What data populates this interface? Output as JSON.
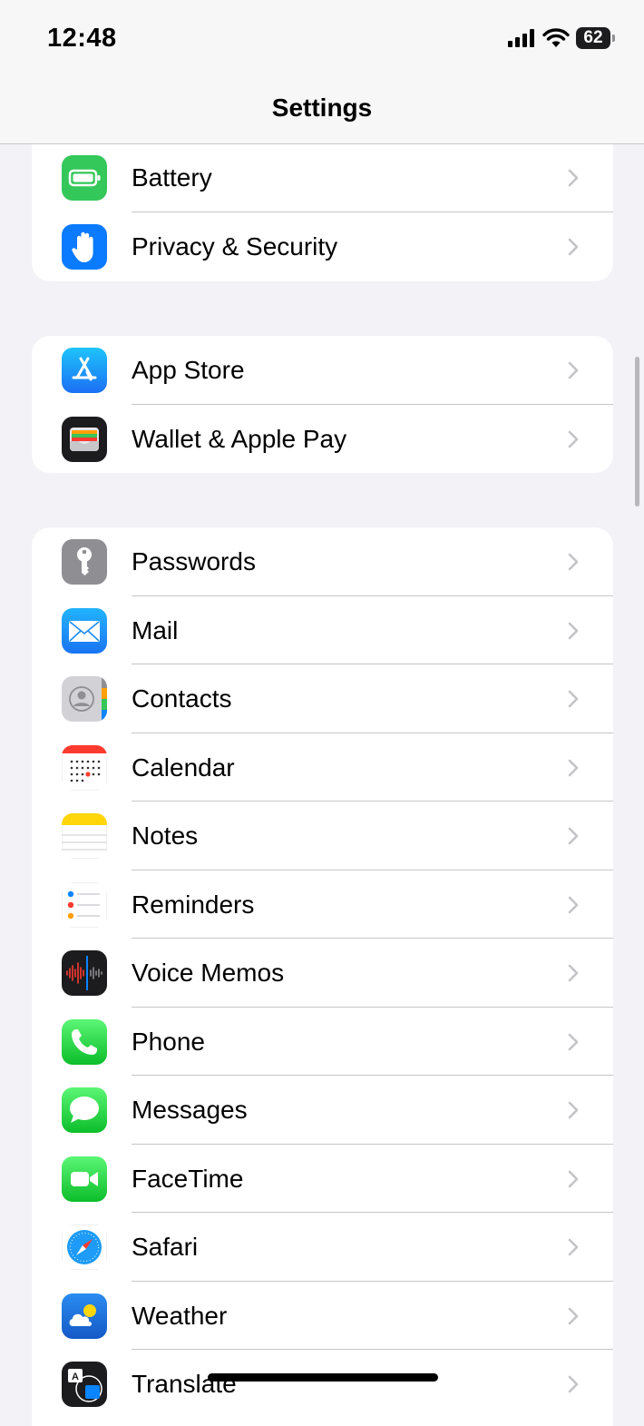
{
  "status_bar": {
    "time": "12:48",
    "battery_level": "62"
  },
  "nav": {
    "title": "Settings"
  },
  "groups": [
    {
      "items": [
        {
          "label": "Battery",
          "icon": "battery-icon"
        },
        {
          "label": "Privacy & Security",
          "icon": "hand-icon"
        }
      ]
    },
    {
      "items": [
        {
          "label": "App Store",
          "icon": "app-store-icon"
        },
        {
          "label": "Wallet & Apple Pay",
          "icon": "wallet-icon"
        }
      ]
    },
    {
      "items": [
        {
          "label": "Passwords",
          "icon": "key-icon"
        },
        {
          "label": "Mail",
          "icon": "mail-icon"
        },
        {
          "label": "Contacts",
          "icon": "contacts-icon"
        },
        {
          "label": "Calendar",
          "icon": "calendar-icon"
        },
        {
          "label": "Notes",
          "icon": "notes-icon"
        },
        {
          "label": "Reminders",
          "icon": "reminders-icon"
        },
        {
          "label": "Voice Memos",
          "icon": "voice-memos-icon"
        },
        {
          "label": "Phone",
          "icon": "phone-icon"
        },
        {
          "label": "Messages",
          "icon": "messages-icon"
        },
        {
          "label": "FaceTime",
          "icon": "facetime-icon"
        },
        {
          "label": "Safari",
          "icon": "safari-icon"
        },
        {
          "label": "Weather",
          "icon": "weather-icon"
        },
        {
          "label": "Translate",
          "icon": "translate-icon"
        }
      ]
    }
  ]
}
